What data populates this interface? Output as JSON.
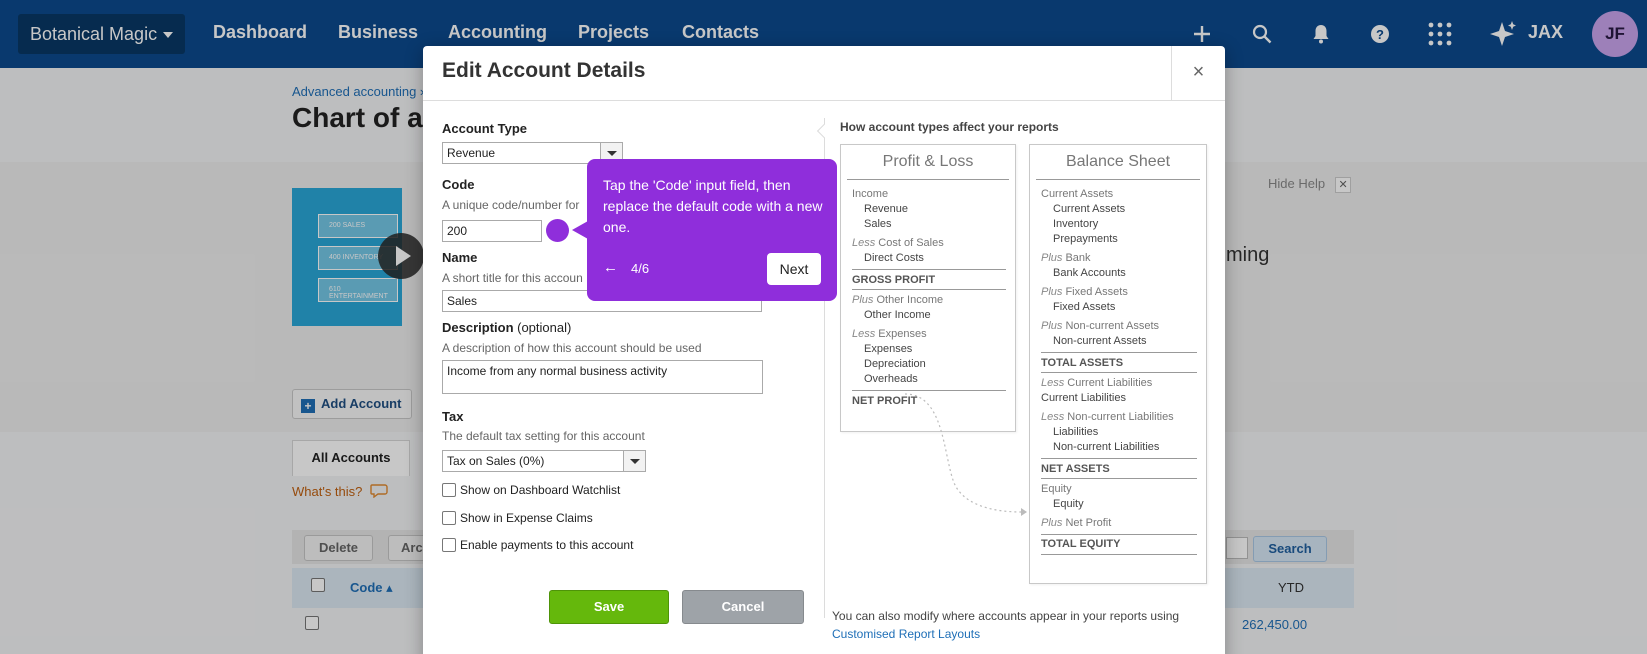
{
  "topnav": {
    "org": "Botanical Magic",
    "links": [
      "Dashboard",
      "Business",
      "Accounting",
      "Projects",
      "Contacts"
    ],
    "jax": "JAX",
    "avatar": "JF"
  },
  "page": {
    "breadcrumb": "Advanced accounting ›",
    "title": "Chart of ac",
    "hide_help": "Hide Help",
    "help_text_partial": "ming",
    "video_rows": [
      "200 SALES",
      "400 INVENTORY",
      "610 ENTERTAINMENT"
    ],
    "add_account": "Add Account",
    "tab_all": "All Accounts",
    "whats_this": "What's this?",
    "delete": "Delete",
    "archive_partial": "Arc",
    "search": "Search",
    "col_code": "Code ▴",
    "col_ytd": "YTD",
    "row_ytd": "262,450.00"
  },
  "modal": {
    "title": "Edit Account Details",
    "close": "×",
    "account_type_label": "Account Type",
    "account_type_value": "Revenue",
    "code_label": "Code",
    "code_hint": "A unique code/number for",
    "code_value": "200",
    "name_label": "Name",
    "name_hint": "A short title for this accoun",
    "name_value": "Sales",
    "desc_label": "Description",
    "desc_optional": " (optional)",
    "desc_hint": "A description of how this account should be used",
    "desc_value": "Income from any normal business activity",
    "tax_label": "Tax",
    "tax_hint": "The default tax setting for this account",
    "tax_value": "Tax on Sales (0%)",
    "chk_watchlist": "Show on Dashboard Watchlist",
    "chk_expense": "Show in Expense Claims",
    "chk_payments": "Enable payments to this account",
    "save": "Save",
    "cancel": "Cancel",
    "foot_note": "You can also modify where accounts appear in your reports using ",
    "foot_link": "Customised Report Layouts"
  },
  "report_help": {
    "heading": "How account types affect your reports",
    "pl": {
      "title": "Profit & Loss",
      "income": "Income",
      "revenue": "Revenue",
      "sales": "Sales",
      "less": "Less",
      "cost_of_sales": " Cost of Sales",
      "direct_costs": "Direct Costs",
      "gross_profit": "GROSS PROFIT",
      "plus": "Plus",
      "other_income_h": " Other Income",
      "other_income": "Other Income",
      "expenses_h": " Expenses",
      "expenses": "Expenses",
      "depreciation": "Depreciation",
      "overheads": "Overheads",
      "net_profit": "NET PROFIT"
    },
    "bs": {
      "title": "Balance Sheet",
      "current_assets_h": "Current Assets",
      "current_assets": "Current Assets",
      "inventory": "Inventory",
      "prepayments": "Prepayments",
      "bank_h": " Bank",
      "bank_accounts": "Bank Accounts",
      "fixed_assets_h": " Fixed Assets",
      "fixed_assets": "Fixed Assets",
      "noncurrent_assets_h": " Non-current Assets",
      "noncurrent_assets": "Non-current Assets",
      "total_assets": "TOTAL ASSETS",
      "current_liab_h": " Current Liabilities",
      "current_liab": "Current Liabilities",
      "noncurrent_liab_h": " Non-current Liabilities",
      "liabilities": "Liabilities",
      "noncurrent_liab": "Non-current Liabilities",
      "net_assets": "NET ASSETS",
      "equity_h": "Equity",
      "equity": "Equity",
      "net_profit_h": " Net Profit",
      "total_equity": "TOTAL EQUITY"
    }
  },
  "tooltip": {
    "text": "Tap the 'Code' input field, then replace the default code with a new one.",
    "back": "←",
    "step": "4/6",
    "next": "Next"
  },
  "colors": {
    "nav": "#0c4a8d",
    "tooltip": "#8f2edb",
    "save": "#65b80c",
    "link": "#1f6fb7"
  }
}
